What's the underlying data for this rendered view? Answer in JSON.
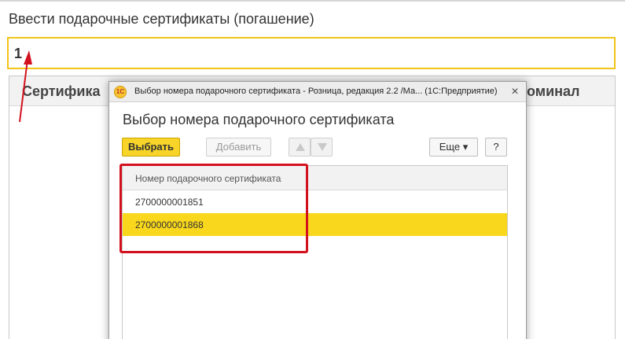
{
  "background_form": {
    "title": "Ввести подарочные сертификаты (погашение)",
    "input_value": "1",
    "table": {
      "columns": [
        "Сертифика",
        "оминал"
      ]
    }
  },
  "dialog": {
    "app_icon_text": "1С",
    "window_title": "Выбор номера подарочного сертификата - Розница, редакция 2.2 /Ма...  (1С:Предприятие)",
    "heading": "Выбор номера подарочного сертификата",
    "toolbar": {
      "select_label": "Выбрать",
      "add_label": "Добавить",
      "more_label": "Еще ▾",
      "help_label": "?"
    },
    "list": {
      "header": "Номер подарочного сертификата",
      "rows": [
        "2700000001851",
        "2700000001868"
      ],
      "selected_index": 1
    }
  },
  "colors": {
    "accent_yellow": "#f9d71c",
    "input_border": "#f2c418",
    "annotation_red": "#d3111e"
  },
  "icons": [
    "app-1c-icon",
    "close-icon",
    "move-up-icon",
    "move-down-icon",
    "dropdown-arrow-icon",
    "annotation-arrow-icon"
  ]
}
